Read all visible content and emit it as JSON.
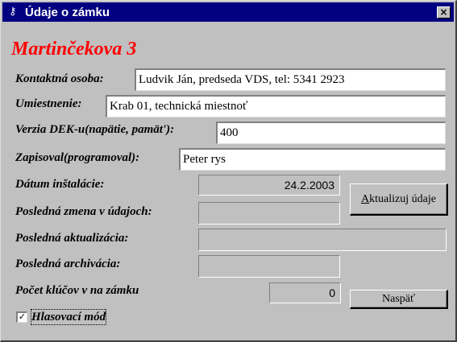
{
  "window": {
    "title": "Údaje o zámku",
    "close_label": "×",
    "app_icon": "key-icon"
  },
  "heading": "Martinčekova 3",
  "fields": {
    "contact": {
      "label": "Kontaktná osoba:",
      "value": "Ludvik Ján, predseda VDS, tel: 5341 2923"
    },
    "location": {
      "label": "Umiestnenie:",
      "value": "Krab 01, technická miestnoť"
    },
    "dek_version": {
      "label": "Verzia DEK-u(napätie, pamät'):",
      "value": "400"
    },
    "programmer": {
      "label": "Zapisoval(programoval):",
      "value": "Peter rys"
    }
  },
  "info": {
    "install_date": {
      "label": "Dátum inštalácie:",
      "value": "24.2.2003"
    },
    "last_change": {
      "label": "Posledná zmena v údajoch:",
      "value": ""
    },
    "last_update": {
      "label": "Posledná aktualizácia:",
      "value": ""
    },
    "last_archive": {
      "label": "Posledná archivácia:",
      "value": ""
    },
    "key_count": {
      "label": "Počet klúčov v na zámku",
      "value": "0"
    }
  },
  "buttons": {
    "update": {
      "accel": "A",
      "rest": "ktualizuj údaje"
    },
    "back": "Naspäť"
  },
  "voting_mode": {
    "label": "Hlasovací mód",
    "checked": true,
    "mark": "✓"
  }
}
